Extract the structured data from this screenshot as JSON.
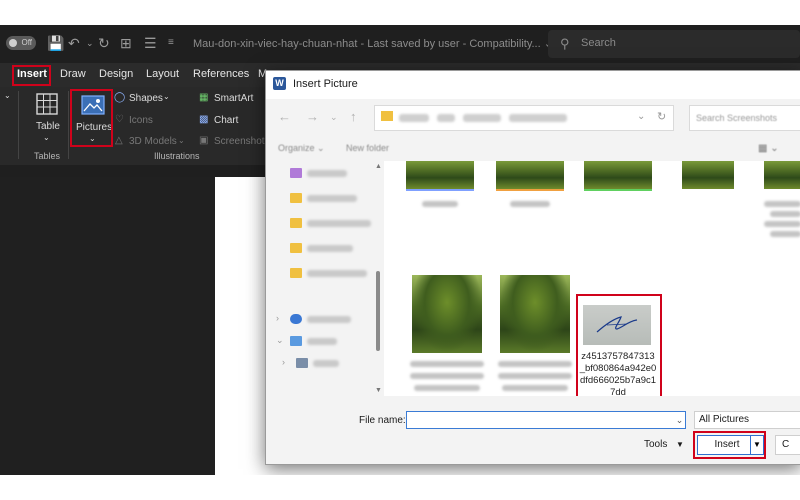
{
  "titlebar": {
    "autosave": "Off",
    "document_title": "Mau-don-xin-viec-hay-chuan-nhat  -  Last saved by user  -  Compatibility... ⌄",
    "search_placeholder": "Search"
  },
  "ribbon_tabs": [
    "Insert",
    "Draw",
    "Design",
    "Layout",
    "References",
    "M"
  ],
  "ribbon": {
    "tables": {
      "button": "Table",
      "group_label": "Tables"
    },
    "illustrations": {
      "pictures": "Pictures",
      "shapes": "Shapes",
      "icons": "Icons",
      "models": "3D Models",
      "smartart": "SmartArt",
      "chart": "Chart",
      "screenshot": "Screenshot",
      "group_label": "Illustrations"
    }
  },
  "dialog": {
    "title": "Insert Picture",
    "search_placeholder": "Search Screenshots",
    "organize": "Organize ⌄",
    "new_folder": "New folder",
    "selected_file": "z4513757847313_bf080864a942e0dfd666025b7a9c17dd",
    "file_name_label": "File name:",
    "file_name_value": "",
    "filter": "All Pictures",
    "tools": "Tools",
    "insert": "Insert",
    "cancel": "C"
  },
  "colors": {
    "highlight": "#d0021b",
    "word_blue": "#2b579a",
    "dark_bg": "#1f1f1f"
  }
}
